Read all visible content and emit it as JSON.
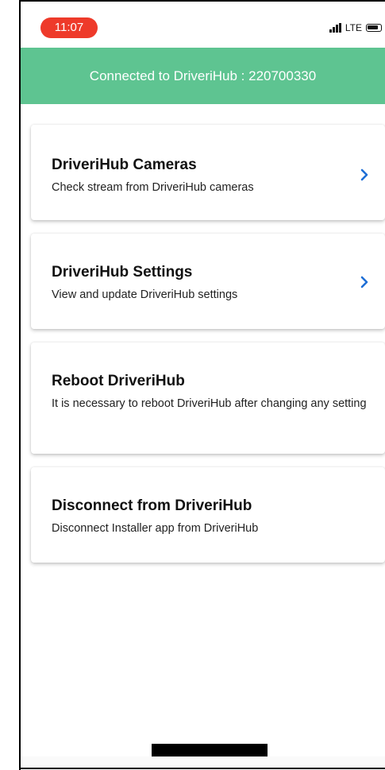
{
  "status_bar": {
    "time": "11:07",
    "network": "LTE",
    "icons": [
      "signal-icon",
      "battery-icon"
    ]
  },
  "banner": {
    "text": "Connected to DriveriHub : 220700330"
  },
  "menu": [
    {
      "title": "DriveriHub Cameras",
      "subtitle": "Check stream from DriveriHub cameras",
      "has_chevron": true
    },
    {
      "title": "DriveriHub Settings",
      "subtitle": "View and update DriveriHub settings",
      "has_chevron": true
    },
    {
      "title": "Reboot DriveriHub",
      "subtitle": "It is necessary to reboot DriveriHub after changing any setting",
      "has_chevron": false
    },
    {
      "title": "Disconnect from DriveriHub",
      "subtitle": "Disconnect Installer app from DriveriHub",
      "has_chevron": false
    }
  ],
  "colors": {
    "banner": "#5ec491",
    "time_pill": "#ee3a2a",
    "chevron": "#1f6fd6"
  }
}
